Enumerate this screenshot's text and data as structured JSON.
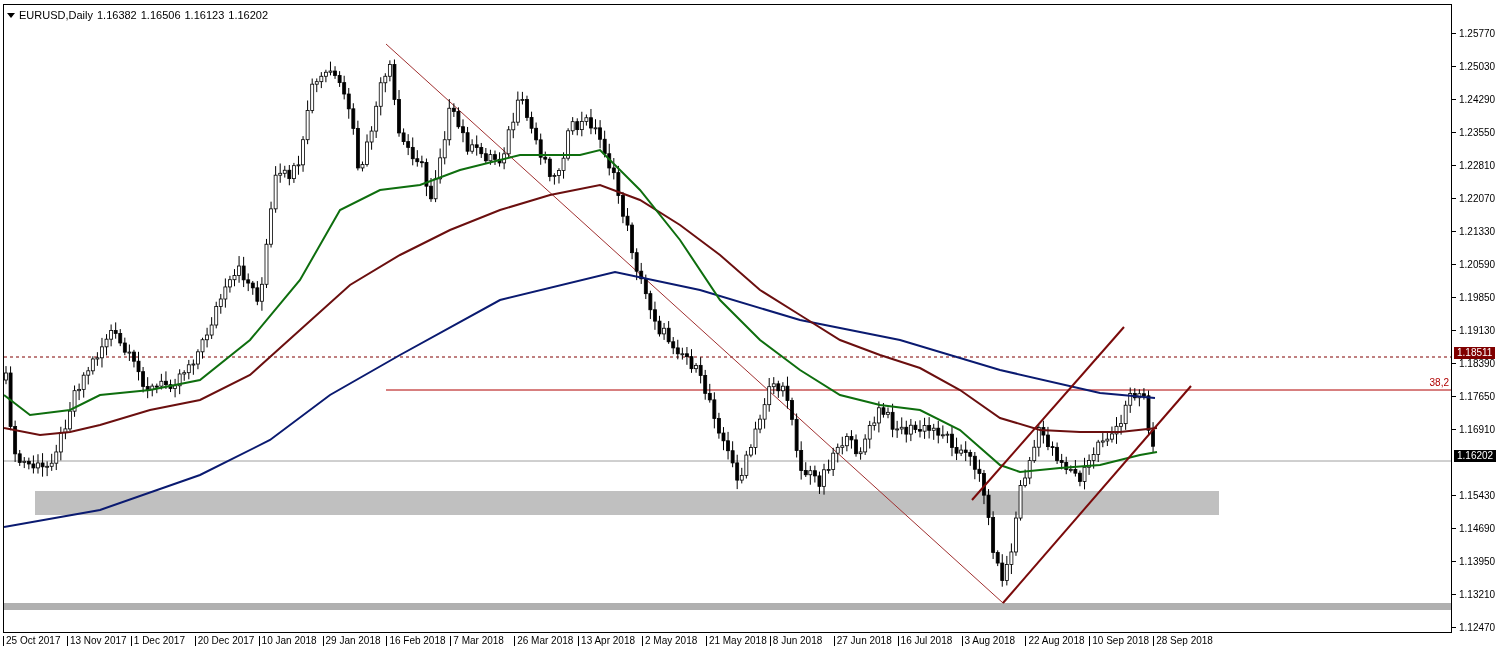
{
  "header": {
    "symbol": "EURUSD,Daily",
    "ohlc": [
      "1.16382",
      "1.16506",
      "1.16123",
      "1.16202"
    ]
  },
  "price_axis": [
    "1.25770",
    "1.25030",
    "1.24290",
    "1.23550",
    "1.22810",
    "1.22070",
    "1.21330",
    "1.20590",
    "1.19850",
    "1.19130",
    "1.18390",
    "1.17650",
    "1.16910",
    "1.15430",
    "1.14690",
    "1.13950",
    "1.13210",
    "1.12470"
  ],
  "price_tags": [
    {
      "text": "1.18511",
      "color": "#800000"
    },
    {
      "text": "1.16202",
      "color": "#000000"
    }
  ],
  "fib_label": "38,2",
  "time_axis": [
    "25 Oct 2017",
    "13 Nov 2017",
    "1 Dec 2017",
    "20 Dec 2017",
    "10 Jan 2018",
    "29 Jan 2018",
    "16 Feb 2018",
    "7 Mar 2018",
    "26 Mar 2018",
    "13 Apr 2018",
    "2 May 2018",
    "21 May 2018",
    "8 Jun 2018",
    "27 Jun 2018",
    "16 Jul 2018",
    "3 Aug 2018",
    "22 Aug 2018",
    "10 Sep 2018",
    "28 Sep 2018"
  ]
}
